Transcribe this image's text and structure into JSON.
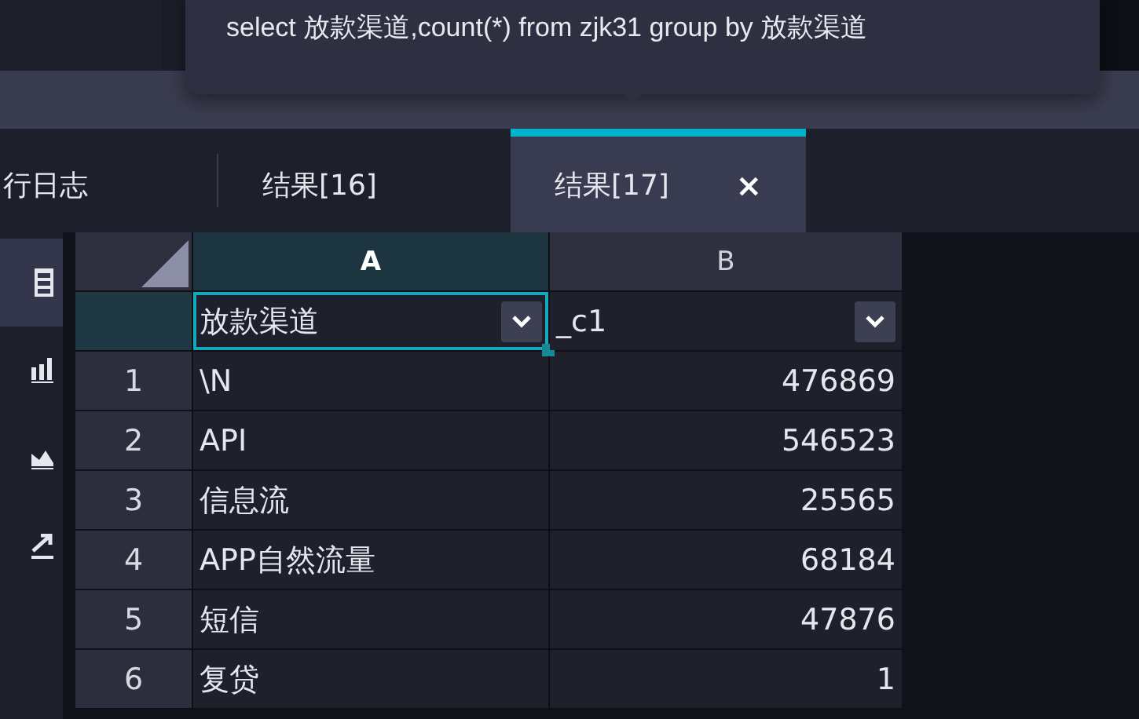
{
  "editor": {
    "tooltip": "select 放款渠道,count(*) from zjk31 group by 放款渠道"
  },
  "tabs": [
    {
      "label": "行日志",
      "selected": false
    },
    {
      "label": "结果[16]",
      "selected": false
    },
    {
      "label": "结果[17]",
      "selected": true,
      "close": "×"
    }
  ],
  "sidebar": {
    "items": [
      {
        "kind": "table",
        "selected": true
      },
      {
        "kind": "bar",
        "selected": false
      },
      {
        "kind": "area",
        "selected": false
      },
      {
        "kind": "line",
        "selected": false
      }
    ]
  },
  "table": {
    "columns": [
      {
        "letter": "A",
        "field": "放款渠道",
        "selected": true,
        "kind": "text"
      },
      {
        "letter": "B",
        "field": "_c1",
        "selected": false,
        "kind": "number"
      }
    ],
    "rows": [
      {
        "number": "1",
        "cells": [
          "\\N",
          "476869"
        ]
      },
      {
        "number": "2",
        "cells": [
          "API",
          "546523"
        ]
      },
      {
        "number": "3",
        "cells": [
          "信息流",
          "25565"
        ]
      },
      {
        "number": "4",
        "cells": [
          "APP自然流量",
          "68184"
        ]
      },
      {
        "number": "5",
        "cells": [
          "短信",
          "47876"
        ]
      },
      {
        "number": "6",
        "cells": [
          "复贷",
          "1"
        ]
      }
    ]
  }
}
